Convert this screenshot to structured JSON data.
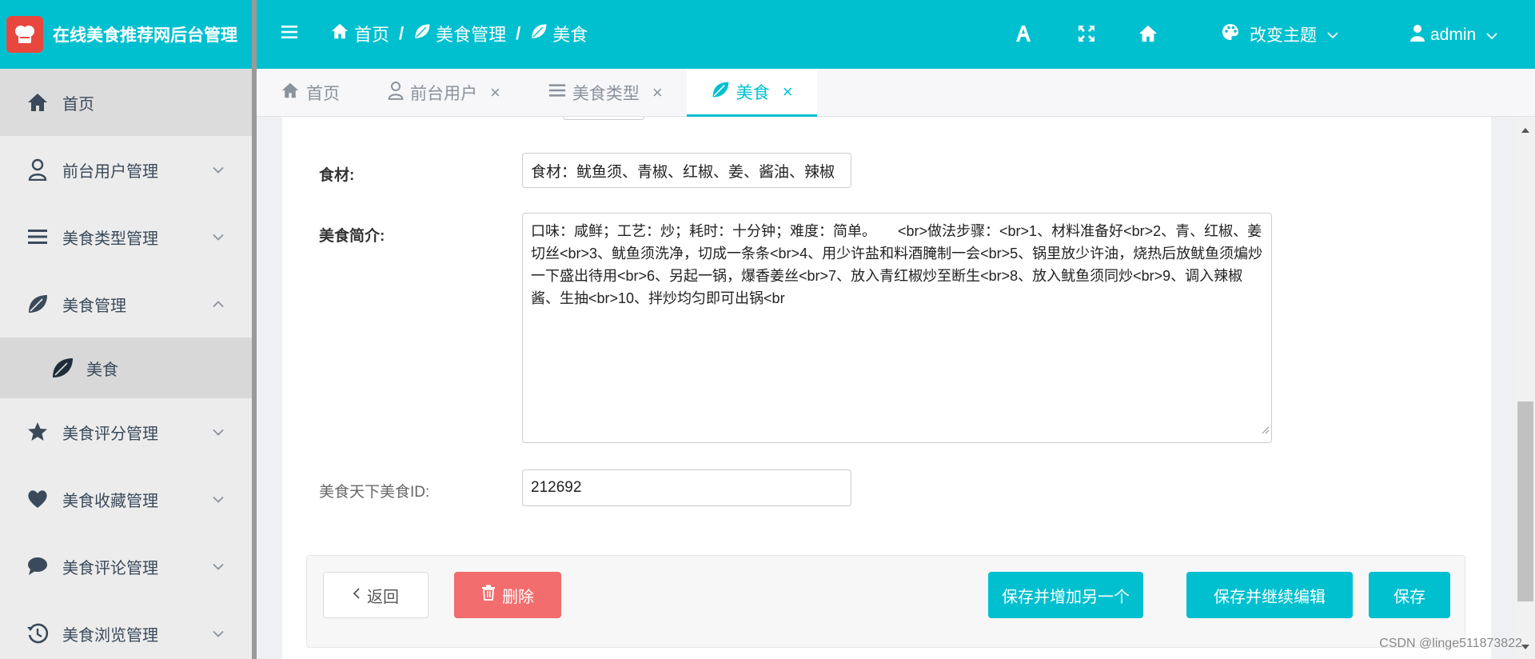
{
  "app": {
    "title": "在线美食推荐网后台管理"
  },
  "sidebar": {
    "items": [
      {
        "label": "首页",
        "icon": "home-icon"
      },
      {
        "label": "前台用户管理",
        "icon": "user-icon"
      },
      {
        "label": "美食类型管理",
        "icon": "list-icon"
      },
      {
        "label": "美食管理",
        "icon": "leaf-icon"
      },
      {
        "label": "美食评分管理",
        "icon": "star-icon"
      },
      {
        "label": "美食收藏管理",
        "icon": "heart-icon"
      },
      {
        "label": "美食评论管理",
        "icon": "comment-icon"
      },
      {
        "label": "美食浏览管理",
        "icon": "history-icon"
      }
    ],
    "sub_item": {
      "label": "美食",
      "icon": "leaf-icon"
    }
  },
  "topbar": {
    "breadcrumb": [
      "首页",
      "美食管理",
      "美食"
    ],
    "theme_label": "改变主题",
    "user_label": "admin"
  },
  "tabs": [
    {
      "label": "首页"
    },
    {
      "label": "前台用户"
    },
    {
      "label": "美食类型"
    },
    {
      "label": "美食"
    }
  ],
  "form": {
    "ingredients_label": "食材:",
    "ingredients_value": "食材：鱿鱼须、青椒、红椒、姜、酱油、辣椒",
    "intro_label": "美食简介:",
    "intro_value": "口味：咸鲜；工艺：炒；耗时：十分钟；难度：简单。　　<br>做法步骤：<br>1、材料准备好<br>2、青、红椒、姜切丝<br>3、鱿鱼须洗净，切成一条条<br>4、用少许盐和料酒腌制一会<br>5、锅里放少许油，烧热后放鱿鱼须煸炒一下盛出待用<br>6、另起一锅，爆香姜丝<br>7、放入青红椒炒至断生<br>8、放入鱿鱼须同炒<br>9、调入辣椒酱、生抽<br>10、拌炒均匀即可出锅<br",
    "id_label": "美食天下美食ID:",
    "id_value": "212692"
  },
  "buttons": {
    "back": "返回",
    "delete": "删除",
    "save_add": "保存并增加另一个",
    "save_continue": "保存并继续编辑",
    "save": "保存"
  },
  "watermark": "CSDN @linge511873822",
  "colors": {
    "accent": "#00c0cf",
    "danger": "#f26d6d",
    "sidebar_bg": "#ececec"
  }
}
